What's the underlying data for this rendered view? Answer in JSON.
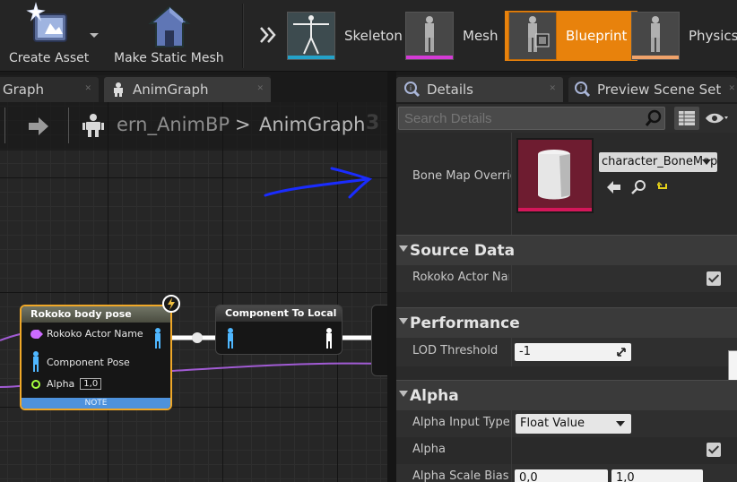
{
  "toolbar": {
    "create_asset": "Create Asset",
    "make_static_mesh": "Make Static Mesh",
    "modes": [
      {
        "label": "Skeleton",
        "accent": "#24a2c9"
      },
      {
        "label": "Mesh",
        "accent": "#d43bd6"
      },
      {
        "label": "Blueprint",
        "accent": "#e8820c"
      },
      {
        "label": "Physics",
        "accent": "#f0a36b"
      }
    ],
    "active_mode": "Blueprint"
  },
  "graph_tabs": [
    {
      "label": "Graph"
    },
    {
      "label": "AnimGraph"
    }
  ],
  "breadcrumb": {
    "asset": "ern_AnimBP",
    "separator": ">",
    "graph": "AnimGraph",
    "zoom_digit": "3"
  },
  "nodes": {
    "rokoko": {
      "title": "Rokoko body pose",
      "pins": {
        "actor_name": "Rokoko Actor Name",
        "component_pose": "Component Pose",
        "alpha": "Alpha"
      },
      "alpha_value": "1,0",
      "footer": "NOTE"
    },
    "to_local": {
      "title": "Component To Local"
    }
  },
  "details": {
    "tabs": [
      {
        "label": "Details"
      },
      {
        "label": "Preview Scene Set"
      }
    ],
    "search_placeholder": "Search Details",
    "bone_map": {
      "label": "Bone Map Override",
      "value": "character_BoneMap"
    },
    "categories": {
      "source_data": "Source Data",
      "performance": "Performance",
      "alpha": "Alpha"
    },
    "props": {
      "rokoko_actor_name": "Rokoko Actor Name",
      "lod_threshold": "LOD Threshold",
      "lod_value": "-1",
      "alpha_input_type": "Alpha Input Type",
      "alpha_input_value": "Float Value",
      "alpha": "Alpha",
      "alpha_scale_bias": "Alpha Scale Bias",
      "bias_min": "0,0",
      "bias_max": "1,0"
    }
  }
}
